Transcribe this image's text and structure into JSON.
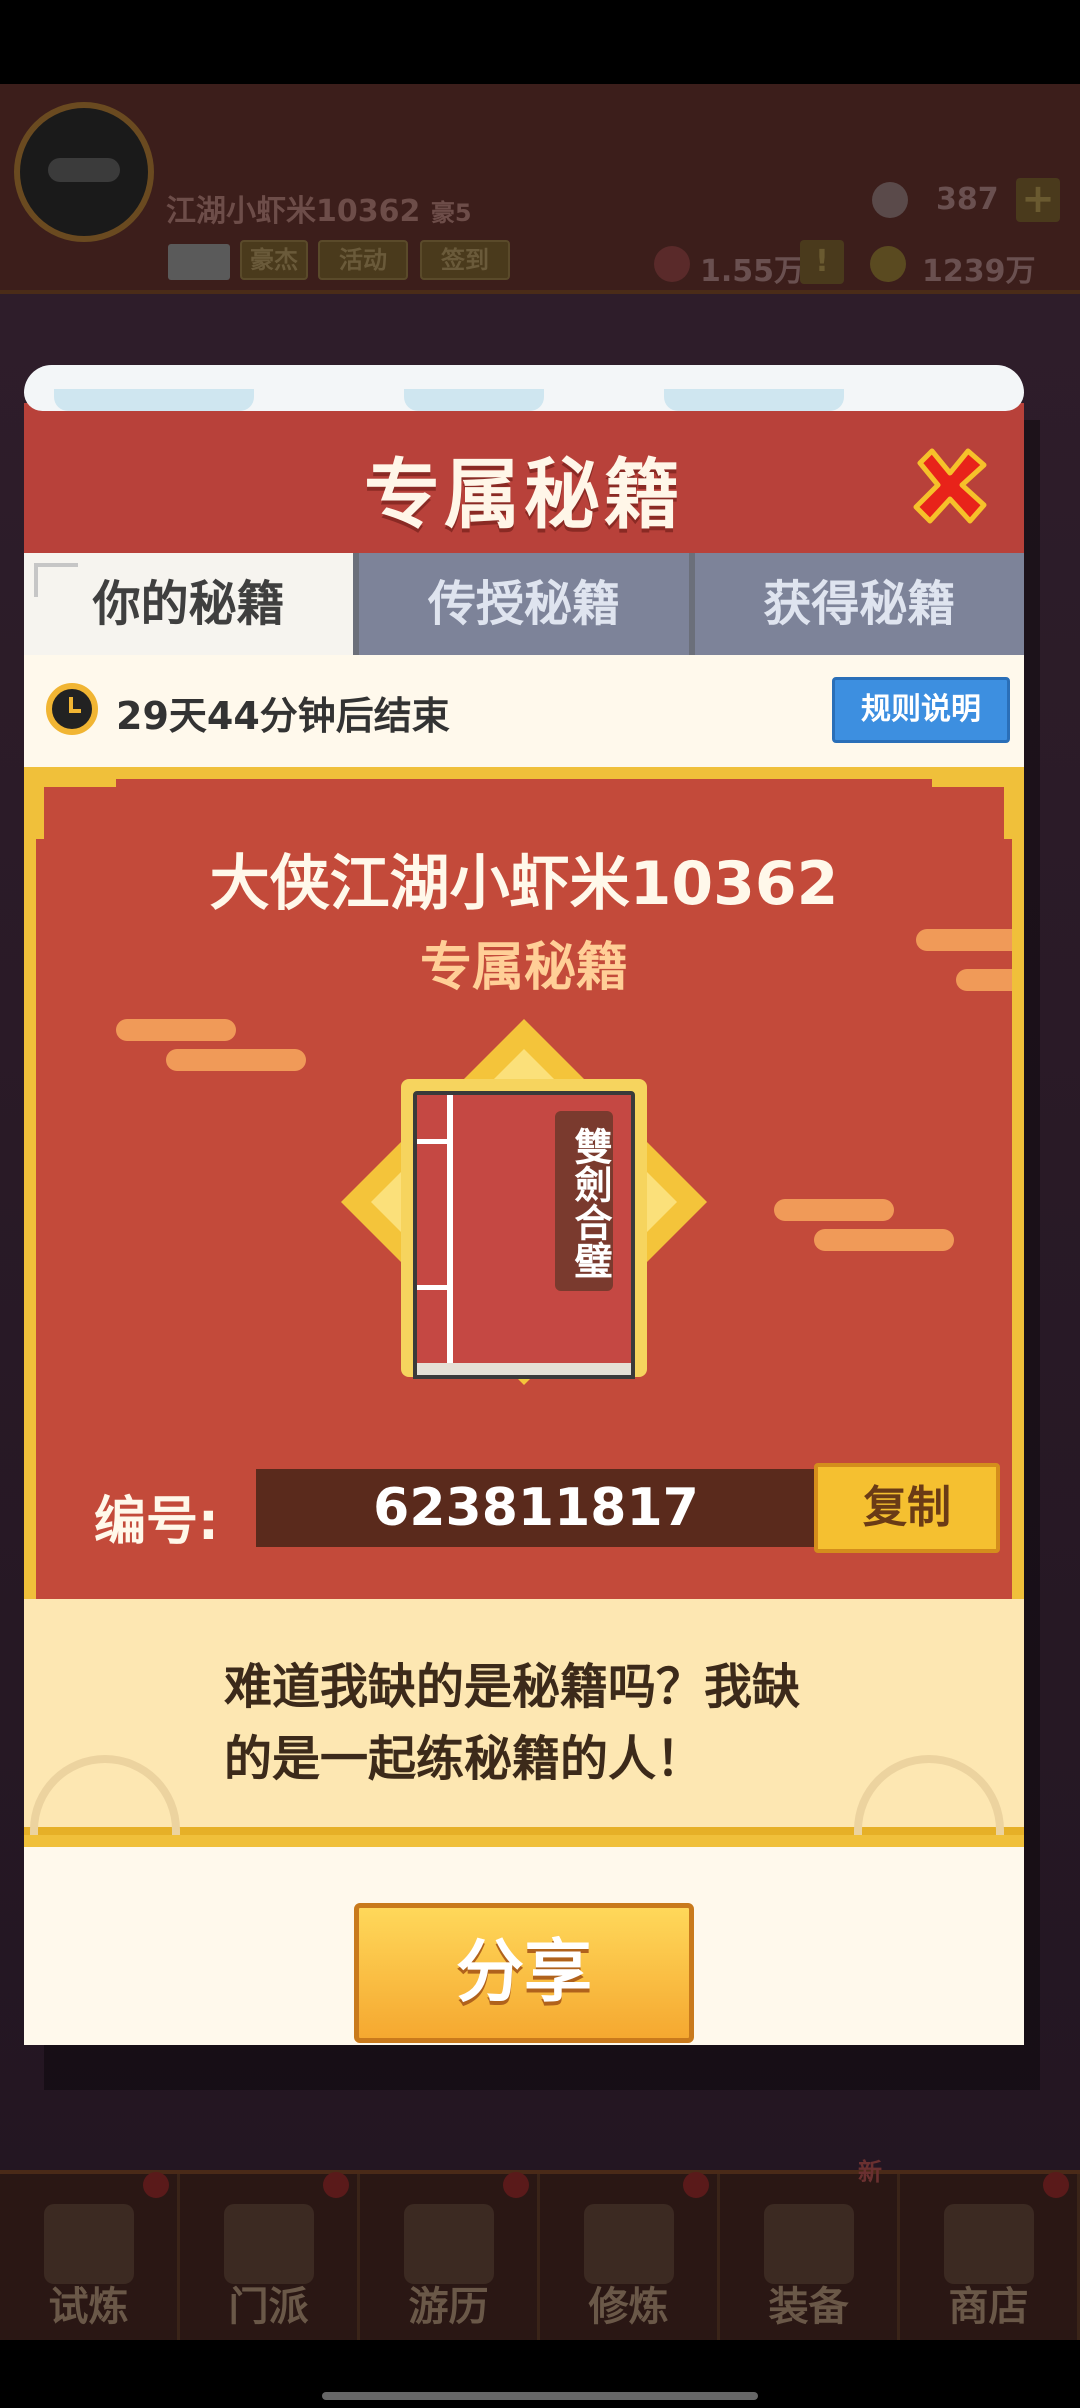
{
  "game_hud": {
    "player_name": "江湖小虾米10362",
    "player_rank": "豪5",
    "hud_buttons": [
      "豪杰",
      "活动",
      "签到"
    ],
    "gems": "387",
    "power": "1.55万",
    "coins": "1239万"
  },
  "modal": {
    "title": "专属秘籍",
    "tabs": [
      {
        "label": "你的秘籍",
        "active": true
      },
      {
        "label": "传授秘籍",
        "active": false
      },
      {
        "label": "获得秘籍",
        "active": false
      }
    ],
    "timer_text": "29天44分钟后结束",
    "rules_button": "规则说明",
    "card": {
      "title": "大侠江湖小虾米10362",
      "subtitle": "专属秘籍",
      "book_name": "雙劍合璧",
      "code_label": "编号:",
      "code_value": "623811817",
      "copy_button": "复制"
    },
    "quote": "难道我缺的是秘籍吗？我缺的是一起练秘籍的人！",
    "share_button": "分享"
  },
  "bottom_nav": {
    "items": [
      "试炼",
      "门派",
      "游历",
      "修炼",
      "装备",
      "商店"
    ],
    "new_badge": "新"
  },
  "colors": {
    "header_red": "#b8413a",
    "card_red": "#c34a3a",
    "gold": "#f0c03a",
    "rules_blue": "#3d8fe0"
  }
}
